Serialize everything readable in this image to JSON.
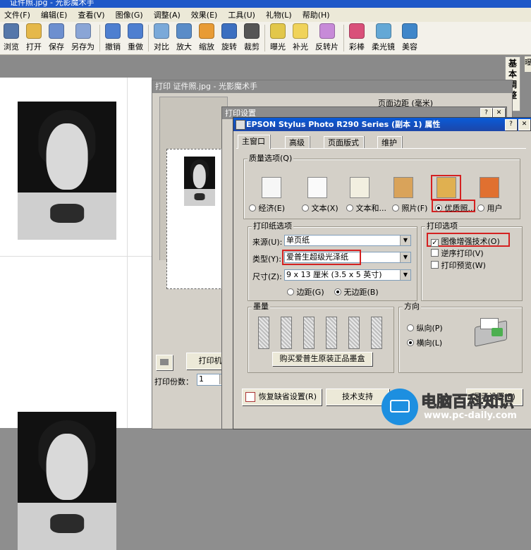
{
  "app": {
    "title": "证件照.jpg - 光影魔术手"
  },
  "menu": [
    "文件(F)",
    "编辑(E)",
    "查看(V)",
    "图像(G)",
    "调整(A)",
    "效果(E)",
    "工具(U)",
    "礼物(L)",
    "帮助(H)"
  ],
  "toolbar": [
    {
      "label": "浏览",
      "icon": "browse-icon",
      "color": "#5577aa"
    },
    {
      "label": "打开",
      "icon": "open-folder-icon",
      "color": "#e5b84a"
    },
    {
      "label": "保存",
      "icon": "save-icon",
      "color": "#6d8fcf"
    },
    {
      "label": "另存为",
      "icon": "save-as-icon",
      "color": "#8aa5d6"
    },
    {
      "label": "撤销",
      "icon": "undo-icon",
      "color": "#4e7fd0"
    },
    {
      "label": "重做",
      "icon": "redo-icon",
      "color": "#4e7fd0"
    },
    {
      "label": "对比",
      "icon": "compare-icon",
      "color": "#7aa9d9"
    },
    {
      "label": "放大",
      "icon": "zoom-in-icon",
      "color": "#5a8cc8"
    },
    {
      "label": "缩放",
      "icon": "resize-icon",
      "color": "#e89b35"
    },
    {
      "label": "旋转",
      "icon": "rotate-icon",
      "color": "#3c6fc0"
    },
    {
      "label": "裁剪",
      "icon": "crop-icon",
      "color": "#555555"
    },
    {
      "label": "曝光",
      "icon": "exposure-icon",
      "color": "#e2c74a"
    },
    {
      "label": "补光",
      "icon": "fill-light-icon",
      "color": "#f0d35a"
    },
    {
      "label": "反转片",
      "icon": "reversal-film-icon",
      "color": "#c78ad8"
    },
    {
      "label": "彩棒",
      "icon": "color-wand-icon",
      "color": "#d9507a"
    },
    {
      "label": "柔光镜",
      "icon": "soft-light-icon",
      "color": "#64a8d6"
    },
    {
      "label": "美容",
      "icon": "beauty-icon",
      "color": "#3f86c9"
    }
  ],
  "side_tab": "基本调整",
  "right_strip": "曝",
  "print_window": {
    "title": "打印 证件照.jpg - 光影魔术手",
    "margin_label": "页面边距 (毫米)",
    "printer_settings_button": "打印机设置",
    "copies_label": "打印份数：",
    "copies_value": "1"
  },
  "setup_window": {
    "title": "打印设置"
  },
  "props": {
    "title": "EPSON Stylus Photo R290 Series (副本 1) 属性",
    "tabs": [
      "主窗口",
      "高级",
      "页面版式",
      "维护"
    ],
    "quality": {
      "group_label": "质量选项(Q)",
      "options": [
        "经济(E)",
        "文本(X)",
        "文本和...",
        "照片(F)",
        "优质照...",
        "用户"
      ],
      "selected": 4
    },
    "paper": {
      "group_label": "打印纸选项",
      "source_label": "来源(U):",
      "source_value": "单页纸",
      "type_label": "类型(Y):",
      "type_value": "爱普生超级光泽纸",
      "size_label": "尺寸(Z):",
      "size_value": "9 x 13 厘米 (3.5 x 5 英寸)",
      "border_label": "边距(G)",
      "borderless_label": "无边距(B)"
    },
    "print_options": {
      "group_label": "打印选项",
      "enhance_label": "图像增强技术(O)",
      "enhance_checked": true,
      "reverse_label": "逆序打印(V)",
      "preview_label": "打印预览(W)"
    },
    "ink": {
      "group_label": "墨量",
      "buy_button": "购买爱普生原装正品墨盒"
    },
    "orientation": {
      "group_label": "方向",
      "portrait": "纵向(P)",
      "landscape": "横向(L)"
    },
    "restore_button": "恢复缺省设置(R)",
    "support_button": "技术支持",
    "show_settings_button": "显示设置(E)"
  },
  "watermark": {
    "brand": "电脑百科知识",
    "url": "www.pc-daily.com"
  }
}
